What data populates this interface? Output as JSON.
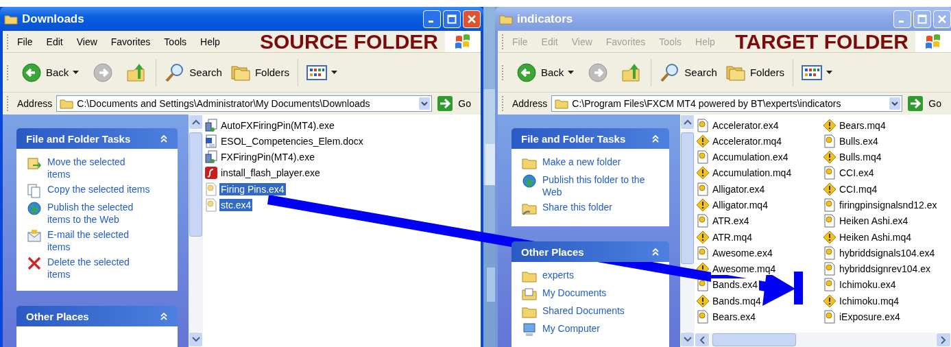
{
  "windows": [
    {
      "title": "Downloads",
      "active": true,
      "menu": [
        "File",
        "Edit",
        "View",
        "Favorites",
        "Tools",
        "Help"
      ],
      "banner": "SOURCE FOLDER",
      "toolbar": {
        "back": "Back",
        "search": "Search",
        "folders": "Folders"
      },
      "address": {
        "label": "Address",
        "value": "C:\\Documents and Settings\\Administrator\\My Documents\\Downloads",
        "go": "Go"
      },
      "panels": [
        {
          "title": "File and Folder Tasks",
          "items": [
            {
              "kind": "move",
              "label": "Move the selected items"
            },
            {
              "kind": "copy",
              "label": "Copy the selected items"
            },
            {
              "kind": "publish",
              "label": "Publish the selected items to the Web"
            },
            {
              "kind": "email",
              "label": "E-mail the selected items"
            },
            {
              "kind": "delete",
              "label": "Delete the selected items"
            }
          ]
        },
        {
          "title": "Other Places"
        }
      ],
      "columns": [
        [
          {
            "kind": "installer",
            "name": "AutoFXFiringPin(MT4).exe",
            "selected": false
          },
          {
            "kind": "document",
            "name": "ESOL_Competencies_Elem.docx",
            "selected": false
          },
          {
            "kind": "installer",
            "name": "FXFiringPin(MT4).exe",
            "selected": false
          },
          {
            "kind": "flash",
            "name": "install_flash_player.exe",
            "selected": false
          },
          {
            "kind": "ex4",
            "name": "Firing Pins.ex4",
            "selected": true
          },
          {
            "kind": "ex4",
            "name": "stc.ex4",
            "selected": true
          }
        ]
      ]
    },
    {
      "title": "indicators",
      "active": false,
      "menu": [
        "File",
        "Edit",
        "View",
        "Favorites",
        "Tools",
        "Help"
      ],
      "banner": "TARGET FOLDER",
      "toolbar": {
        "back": "Back",
        "search": "Search",
        "folders": "Folders"
      },
      "address": {
        "label": "Address",
        "value": "C:\\Program Files\\FXCM MT4 powered by BT\\experts\\indicators",
        "go": "Go"
      },
      "panels": [
        {
          "title": "File and Folder Tasks",
          "items": [
            {
              "kind": "newfolder",
              "label": "Make a new folder"
            },
            {
              "kind": "publish",
              "label": "Publish this folder to the Web"
            },
            {
              "kind": "share",
              "label": "Share this folder"
            }
          ]
        },
        {
          "title": "Other Places",
          "items": [
            {
              "kind": "folder",
              "label": "experts"
            },
            {
              "kind": "documents",
              "label": "My Documents"
            },
            {
              "kind": "folder",
              "label": "Shared Documents"
            },
            {
              "kind": "computer",
              "label": "My Computer"
            }
          ]
        }
      ],
      "columns": [
        [
          {
            "kind": "ex4",
            "name": "Accelerator.ex4",
            "selected": false
          },
          {
            "kind": "mq4",
            "name": "Accelerator.mq4",
            "selected": false
          },
          {
            "kind": "ex4",
            "name": "Accumulation.ex4",
            "selected": false
          },
          {
            "kind": "mq4",
            "name": "Accumulation.mq4",
            "selected": false
          },
          {
            "kind": "ex4",
            "name": "Alligator.ex4",
            "selected": false
          },
          {
            "kind": "mq4",
            "name": "Alligator.mq4",
            "selected": false
          },
          {
            "kind": "ex4",
            "name": "ATR.ex4",
            "selected": false
          },
          {
            "kind": "mq4",
            "name": "ATR.mq4",
            "selected": false
          },
          {
            "kind": "ex4",
            "name": "Awesome.ex4",
            "selected": false
          },
          {
            "kind": "mq4",
            "name": "Awesome.mq4",
            "selected": false
          },
          {
            "kind": "ex4",
            "name": "Bands.ex4",
            "selected": false
          },
          {
            "kind": "mq4",
            "name": "Bands.mq4",
            "selected": false
          },
          {
            "kind": "ex4",
            "name": "Bears.ex4",
            "selected": false
          }
        ],
        [
          {
            "kind": "mq4",
            "name": "Bears.mq4",
            "selected": false
          },
          {
            "kind": "ex4",
            "name": "Bulls.ex4",
            "selected": false
          },
          {
            "kind": "mq4",
            "name": "Bulls.mq4",
            "selected": false
          },
          {
            "kind": "ex4",
            "name": "CCI.ex4",
            "selected": false
          },
          {
            "kind": "mq4",
            "name": "CCI.mq4",
            "selected": false
          },
          {
            "kind": "ex4",
            "name": "firingpinsignalsnd12.ex",
            "selected": false
          },
          {
            "kind": "ex4",
            "name": "Heiken Ashi.ex4",
            "selected": false
          },
          {
            "kind": "mq4",
            "name": "Heiken Ashi.mq4",
            "selected": false
          },
          {
            "kind": "ex4",
            "name": "hybriddsignals104.ex4",
            "selected": false
          },
          {
            "kind": "ex4",
            "name": "hybriddsignrev104.ex",
            "selected": false
          },
          {
            "kind": "ex4",
            "name": "Ichimoku.ex4",
            "selected": false
          },
          {
            "kind": "mq4",
            "name": "Ichimoku.mq4",
            "selected": false
          },
          {
            "kind": "ex4",
            "name": "iExposure.ex4",
            "selected": false
          }
        ]
      ]
    }
  ]
}
